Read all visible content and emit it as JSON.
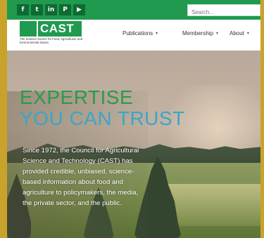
{
  "social": [
    {
      "icon": "facebook-icon",
      "glyph": "f"
    },
    {
      "icon": "twitter-icon",
      "glyph": "t"
    },
    {
      "icon": "linkedin-icon",
      "glyph": "in"
    },
    {
      "icon": "pinterest-icon",
      "glyph": "P"
    },
    {
      "icon": "youtube-icon",
      "glyph": "▶"
    }
  ],
  "search": {
    "placeholder": "Search..."
  },
  "logo": {
    "name": "CAST",
    "tagline": "The Science Source for Food, Agricultural, and Environmental Issues"
  },
  "nav": {
    "items": [
      {
        "label": "Publications"
      },
      {
        "label": "Membership"
      },
      {
        "label": "About"
      }
    ],
    "caret": "▾"
  },
  "hero": {
    "headline_1": "EXPERTISE",
    "headline_2": "YOU CAN TRUST",
    "body": "Since 1972, the Council for Agricultural Science and Technology (CAST) has provided credible, unbiased, science-based information about food and agriculture to policymakers, the media, the private sector, and the public."
  },
  "colors": {
    "brand_green": "#1f9a4e",
    "headline_blue": "#3aa5c9",
    "page_border": "#c9a22b"
  }
}
